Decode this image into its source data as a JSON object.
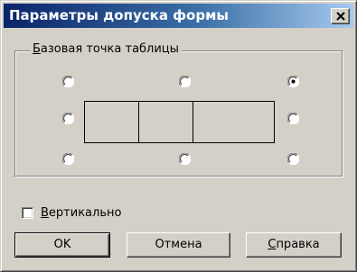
{
  "window": {
    "title": "Параметры допуска формы",
    "close_icon": "close-icon"
  },
  "group": {
    "label": "Базовая точка таблицы"
  },
  "anchor_points": [
    {
      "id": "top-left",
      "selected": false
    },
    {
      "id": "top-center",
      "selected": false
    },
    {
      "id": "top-right",
      "selected": true
    },
    {
      "id": "middle-left",
      "selected": false
    },
    {
      "id": "middle-right",
      "selected": false
    },
    {
      "id": "bottom-left",
      "selected": false
    },
    {
      "id": "bottom-center",
      "selected": false
    },
    {
      "id": "bottom-right",
      "selected": false
    }
  ],
  "vertical_checkbox": {
    "label": "Вертикально",
    "checked": false
  },
  "buttons": {
    "ok": "OK",
    "cancel": "Отмена",
    "help": "Справка"
  },
  "colors": {
    "face": "#d4d0c8",
    "title_start": "#0a246a",
    "title_end": "#a6caf0"
  }
}
